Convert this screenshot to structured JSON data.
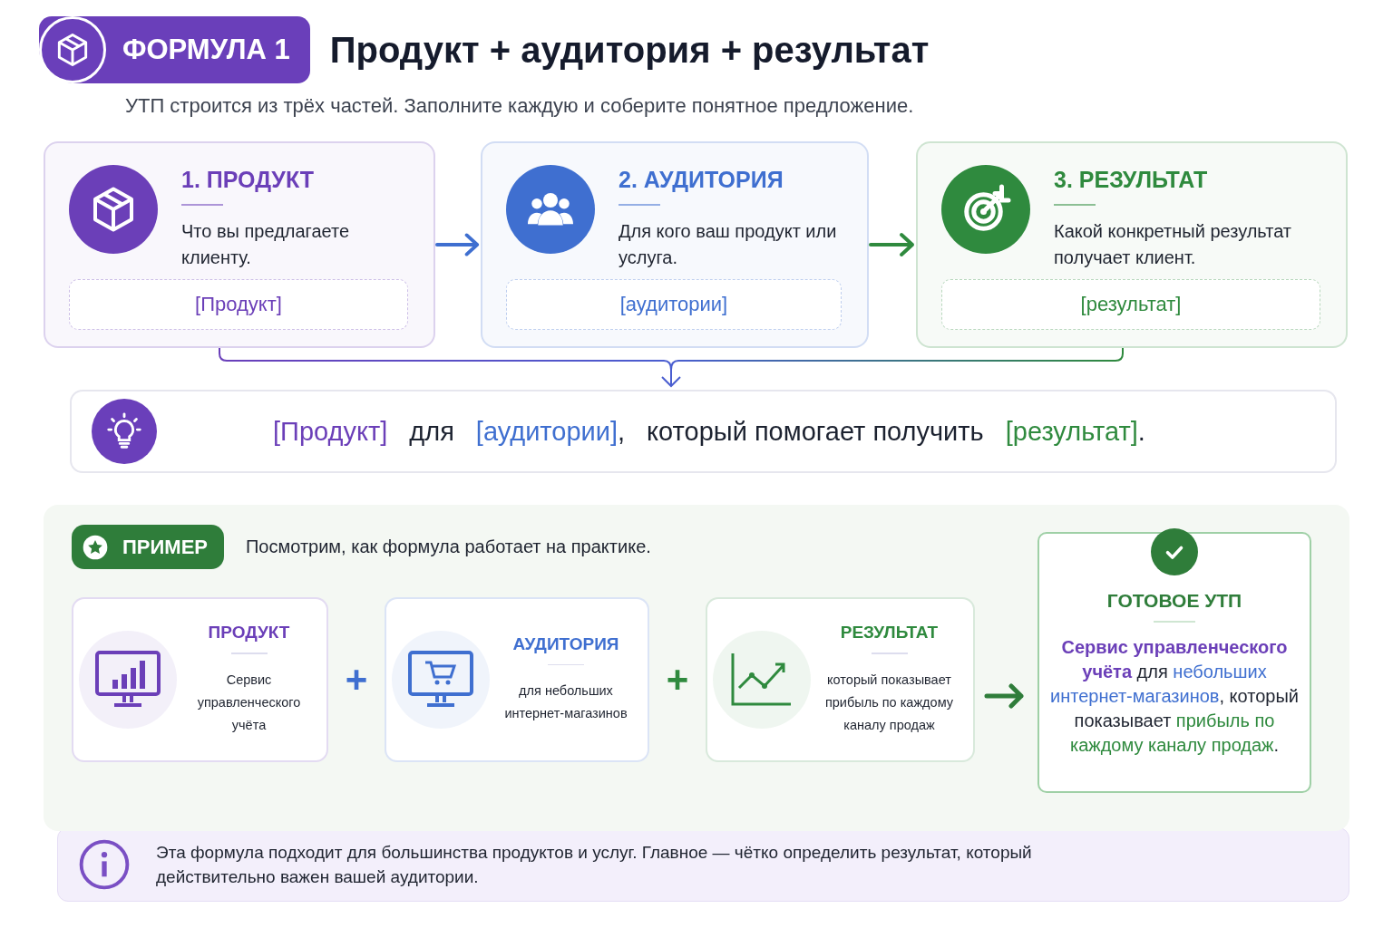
{
  "header": {
    "badge": "ФОРМУЛА 1",
    "title": "Продукт + аудитория + результат",
    "subtitle": "УТП строится из трёх частей. Заполните каждую и соберите понятное предложение."
  },
  "steps": [
    {
      "kind": "product",
      "color": "#6b3fb8",
      "title": "1. ПРОДУКТ",
      "description": "Что вы предлагаете клиенту.",
      "slot": "[Продукт]"
    },
    {
      "kind": "audience",
      "color": "#3f6fd0",
      "title": "2. АУДИТОРИЯ",
      "description": "Для кого ваш продукт или услуга.",
      "slot": "[аудитории]"
    },
    {
      "kind": "result",
      "color": "#2f8a3e",
      "title": "3. РЕЗУЛЬТАТ",
      "description": "Какой конкретный результат получает клиент.",
      "slot": "[результат]"
    }
  ],
  "formula": [
    {
      "kind": "slot",
      "text": "[Продукт]",
      "color": "#6b3fb8"
    },
    {
      "kind": "word",
      "text": "для"
    },
    {
      "kind": "slot",
      "text": "[аудитории]",
      "color": "#3f6fd0"
    },
    {
      "kind": "punct",
      "text": ","
    },
    {
      "kind": "word",
      "text": "который помогает получить"
    },
    {
      "kind": "slot",
      "text": "[результат]",
      "color": "#2f8a3e"
    },
    {
      "kind": "punct",
      "text": "."
    }
  ],
  "example": {
    "badge": "ПРИМЕР",
    "intro": "Посмотрим, как формула работает на практике.",
    "items": [
      {
        "kind": "product",
        "color": "#6b3fb8",
        "title": "ПРОДУКТ",
        "text": "Сервис управленческого учёта"
      },
      {
        "kind": "audience",
        "color": "#3f6fd0",
        "title": "АУДИТОРИЯ",
        "text": "для небольших интернет-магазинов"
      },
      {
        "kind": "result",
        "color": "#2f8a3e",
        "title": "РЕЗУЛЬТАТ",
        "text": "который показывает прибыль по каждому каналу продаж"
      }
    ],
    "operators": [
      "+",
      "+"
    ],
    "result": {
      "title": "ГОТОВОЕ УТП",
      "parts": [
        {
          "kind": "strong",
          "text": "Сервис управленческого учёта",
          "color": "#6b3fb8"
        },
        {
          "kind": "plain",
          "text": " для "
        },
        {
          "kind": "highlight",
          "text": "небольших интернет-магазинов",
          "color": "#3f6fd0"
        },
        {
          "kind": "plain",
          "text": ", который показывает "
        },
        {
          "kind": "highlight",
          "text": "прибыль по каждому каналу продаж",
          "color": "#2f8a3e"
        },
        {
          "kind": "plain",
          "text": "."
        }
      ]
    }
  },
  "note": "Эта формула подходит для большинства продуктов и услуг. Главное — чётко определить результат, который действительно важен вашей аудитории."
}
